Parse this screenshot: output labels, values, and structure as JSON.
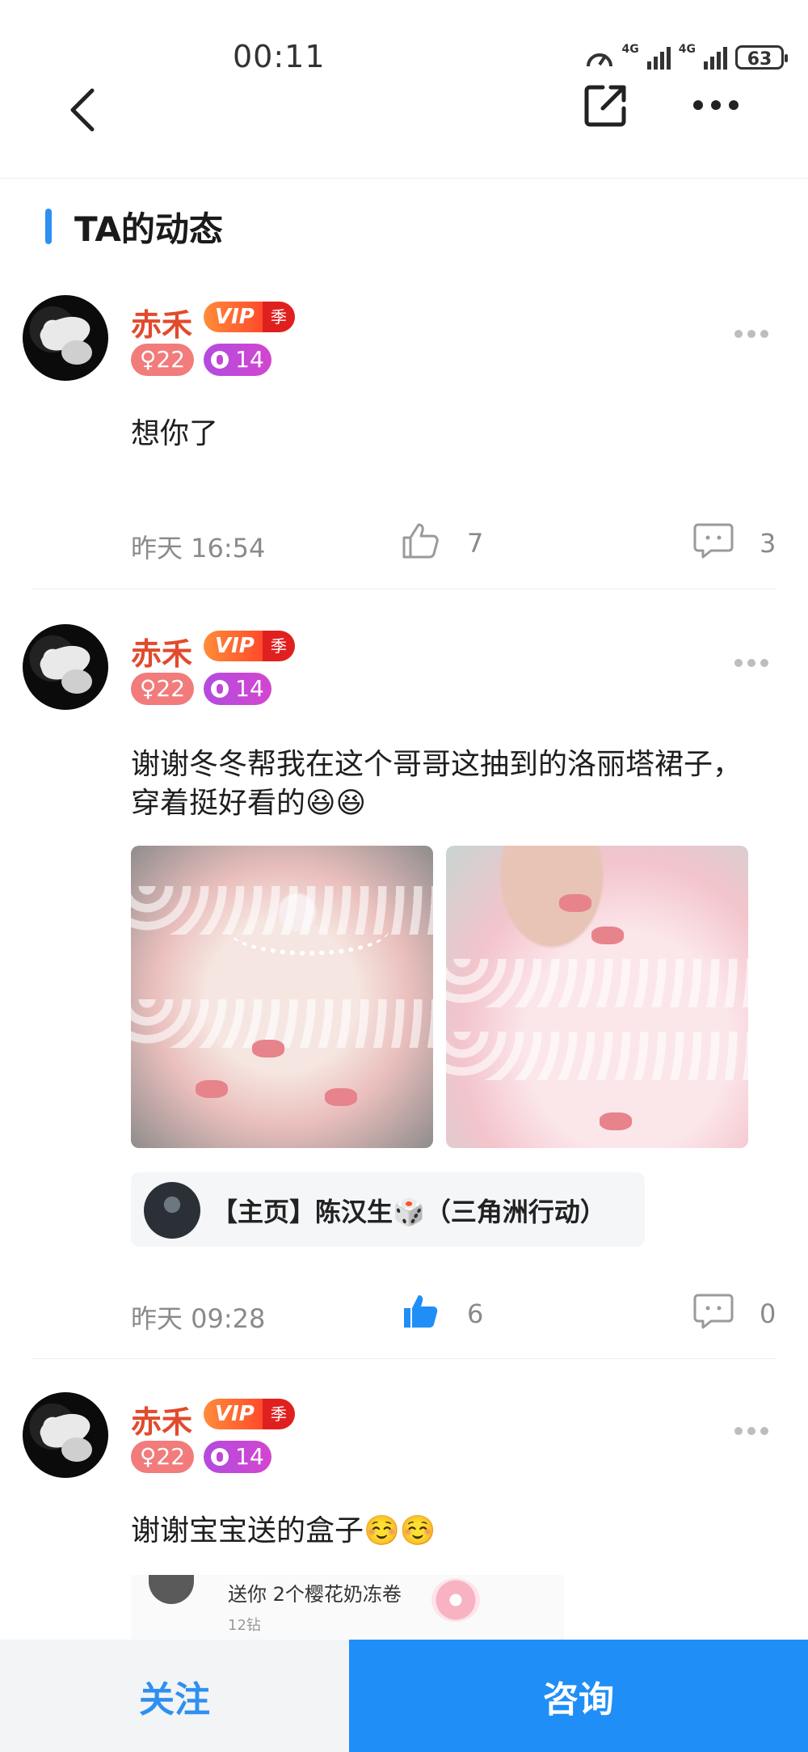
{
  "status_bar": {
    "time": "00:11",
    "network_1": "4G",
    "network_2": "4G",
    "battery": "63"
  },
  "section": {
    "title": "TA的动态"
  },
  "user": {
    "name": "赤禾",
    "vip": "VIP",
    "season": "季",
    "gender_age": "♀22",
    "level": "14"
  },
  "posts": [
    {
      "text": "想你了",
      "time": "昨天 16:54",
      "likes": "7",
      "comments": "3",
      "liked": false
    },
    {
      "text": "谢谢冬冬帮我在这个哥哥这抽到的洛丽塔裙子，穿着挺好看的😆😆",
      "time": "昨天 09:28",
      "likes": "6",
      "comments": "0",
      "liked": true,
      "link_card": {
        "text": "【主页】陈汉生🎲（三角洲行动）"
      }
    },
    {
      "text": "谢谢宝宝送的盒子☺️☺️",
      "gift": {
        "text": "送你 2个樱花奶冻卷",
        "price": "12钻"
      }
    }
  ],
  "bottom": {
    "follow_label": "关注",
    "consult_label": "咨询"
  },
  "colors": {
    "accent": "#1f8ef7",
    "name": "#e24a2c",
    "like_active": "#1f8ef7"
  }
}
